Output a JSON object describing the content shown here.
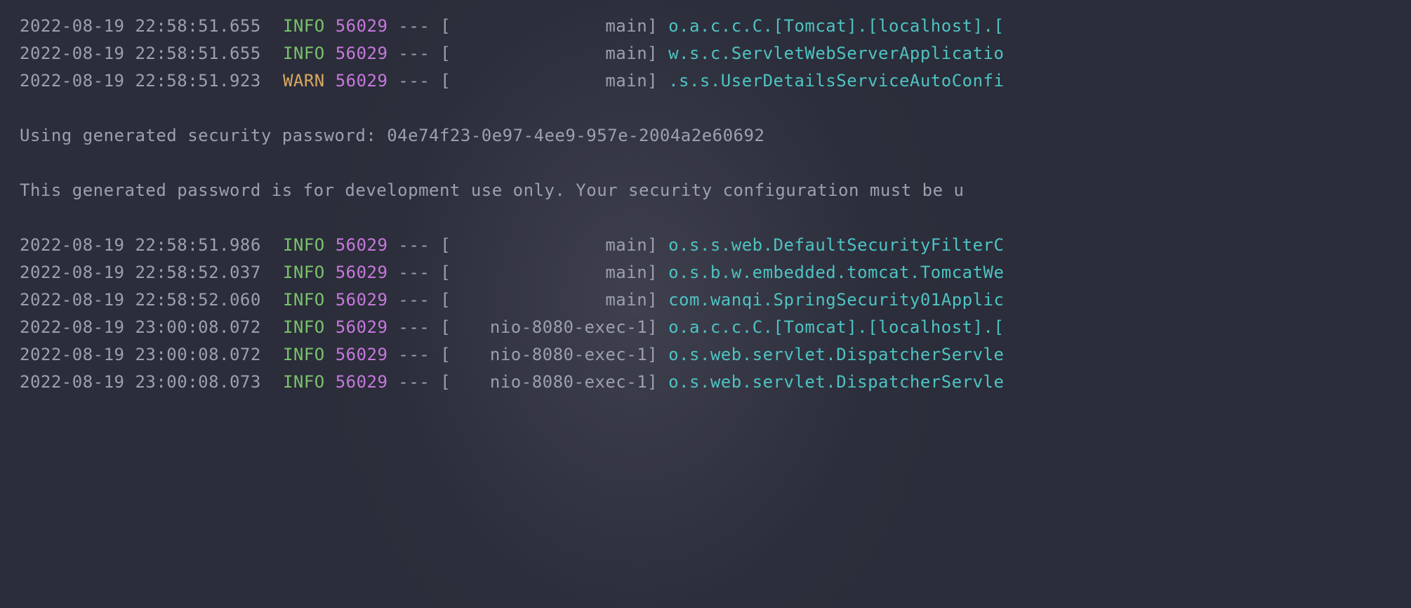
{
  "lines": [
    {
      "type": "log",
      "timestamp": "2022-08-19 22:58:51.655",
      "level": "INFO",
      "levelClass": "level-info",
      "pid": "56029",
      "thread": "main",
      "logger": "o.a.c.c.C.[Tomcat].[localhost].["
    },
    {
      "type": "log",
      "timestamp": "2022-08-19 22:58:51.655",
      "level": "INFO",
      "levelClass": "level-info",
      "pid": "56029",
      "thread": "main",
      "logger": "w.s.c.ServletWebServerApplicatio"
    },
    {
      "type": "log",
      "timestamp": "2022-08-19 22:58:51.923",
      "level": "WARN",
      "levelClass": "level-warn",
      "pid": "56029",
      "thread": "main",
      "logger": ".s.s.UserDetailsServiceAutoConfi"
    },
    {
      "type": "blank"
    },
    {
      "type": "plain",
      "text": "Using generated security password: 04e74f23-0e97-4ee9-957e-2004a2e60692"
    },
    {
      "type": "blank"
    },
    {
      "type": "plain",
      "text": "This generated password is for development use only. Your security configuration must be u"
    },
    {
      "type": "blank"
    },
    {
      "type": "log",
      "timestamp": "2022-08-19 22:58:51.986",
      "level": "INFO",
      "levelClass": "level-info",
      "pid": "56029",
      "thread": "main",
      "logger": "o.s.s.web.DefaultSecurityFilterC"
    },
    {
      "type": "log",
      "timestamp": "2022-08-19 22:58:52.037",
      "level": "INFO",
      "levelClass": "level-info",
      "pid": "56029",
      "thread": "main",
      "logger": "o.s.b.w.embedded.tomcat.TomcatWe"
    },
    {
      "type": "log",
      "timestamp": "2022-08-19 22:58:52.060",
      "level": "INFO",
      "levelClass": "level-info",
      "pid": "56029",
      "thread": "main",
      "logger": "com.wanqi.SpringSecurity01Applic"
    },
    {
      "type": "log",
      "timestamp": "2022-08-19 23:00:08.072",
      "level": "INFO",
      "levelClass": "level-info",
      "pid": "56029",
      "thread": "nio-8080-exec-1",
      "logger": "o.a.c.c.C.[Tomcat].[localhost].["
    },
    {
      "type": "log",
      "timestamp": "2022-08-19 23:00:08.072",
      "level": "INFO",
      "levelClass": "level-info",
      "pid": "56029",
      "thread": "nio-8080-exec-1",
      "logger": "o.s.web.servlet.DispatcherServle"
    },
    {
      "type": "log",
      "timestamp": "2022-08-19 23:00:08.073",
      "level": "INFO",
      "levelClass": "level-info",
      "pid": "56029",
      "thread": "nio-8080-exec-1",
      "logger": "o.s.web.servlet.DispatcherServle"
    }
  ]
}
